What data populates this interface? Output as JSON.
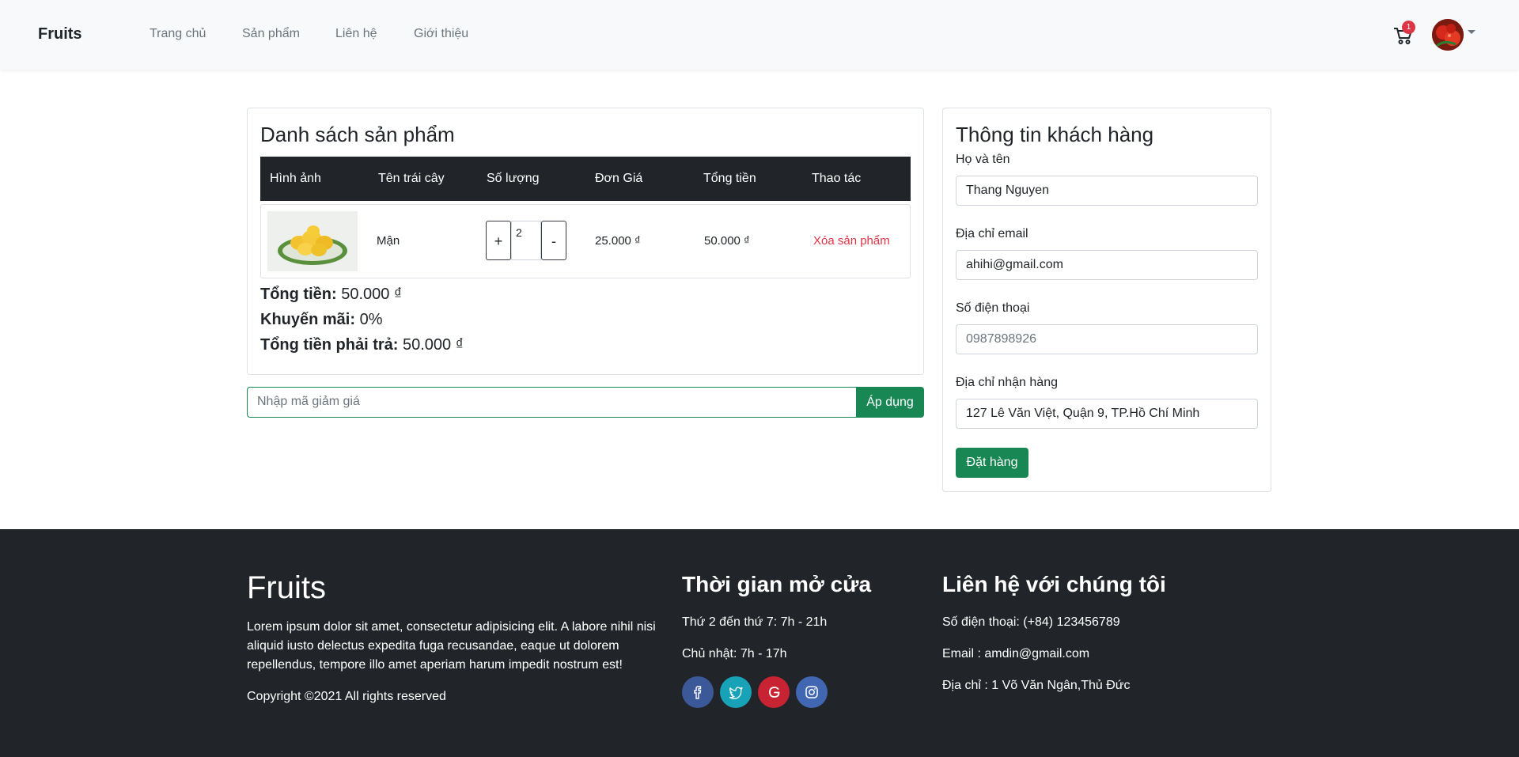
{
  "nav": {
    "brand": "Fruits",
    "links": [
      "Trang chủ",
      "Sản phẩm",
      "Liên hệ",
      "Giới thiệu"
    ],
    "cart_count": "1"
  },
  "cart": {
    "title": "Danh sách sản phẩm",
    "columns": [
      "Hình ảnh",
      "Tên trái cây",
      "Số lượng",
      "Đơn Giá",
      "Tổng tiền",
      "Thao tác"
    ],
    "items": [
      {
        "name": "Mận",
        "minus_label": "+",
        "quantity": "2",
        "plus_label": "-",
        "unit_price": "25.000 ₫",
        "total": "50.000 ₫",
        "action": "Xóa sản phẩm"
      }
    ],
    "summary": {
      "total_label": "Tổng tiền:",
      "total_value": "50.000 ₫",
      "discount_label": "Khuyến mãi:",
      "discount_value": "0%",
      "payable_label": "Tổng tiền phải trả:",
      "payable_value": "50.000 ₫"
    },
    "coupon_placeholder": "Nhập mã giảm giá",
    "coupon_button": "Áp dụng"
  },
  "customer": {
    "title": "Thông tin khách hàng",
    "name_label": "Họ và tên",
    "name_value": "Thang Nguyen",
    "email_label": "Địa chỉ email",
    "email_value": "ahihi@gmail.com",
    "phone_label": "Số điện thoại",
    "phone_placeholder": "0987898926",
    "address_label": "Địa chỉ nhận hàng",
    "address_value": "127 Lê Văn Việt, Quận 9, TP.Hồ Chí Minh",
    "order_button": "Đặt hàng"
  },
  "footer": {
    "brand": "Fruits",
    "description": "Lorem ipsum dolor sit amet, consectetur adipisicing elit. A labore nihil nisi aliquid iusto delectus expedita fuga recusandae, eaque ut dolorem repellendus, tempore illo amet aperiam harum impedit nostrum est!",
    "copyright": "Copyright ©2021 All rights reserved",
    "hours_title": "Thời gian mở cửa",
    "hours_weekday": "Thứ 2 đến thứ 7: 7h - 21h",
    "hours_sunday": "Chủ nhật: 7h - 17h",
    "contact_title": "Liên hệ với chúng tôi",
    "contact_phone": "Số điện thoại: (+84) 123456789",
    "contact_email": "Email : amdin@gmail.com",
    "contact_address": "Địa chỉ : 1 Võ Văn Ngân,Thủ Đức",
    "social": [
      {
        "icon": "facebook-icon",
        "color": "#3b5998"
      },
      {
        "icon": "twitter-icon",
        "color": "#17a2b8"
      },
      {
        "icon": "google-icon",
        "color": "#c82333"
      },
      {
        "icon": "instagram-icon",
        "color": "#4267b2"
      }
    ]
  }
}
